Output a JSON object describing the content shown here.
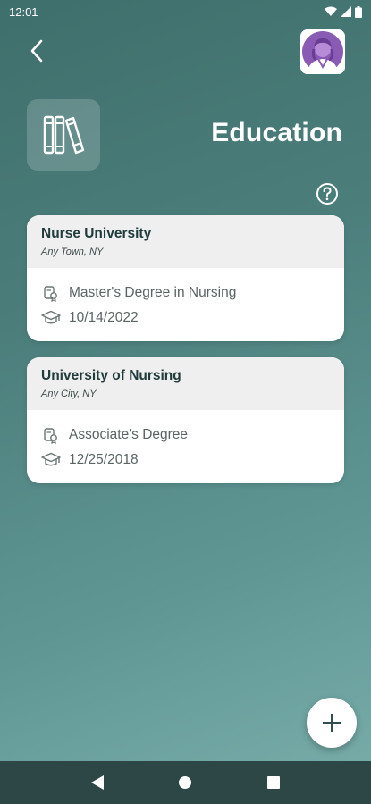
{
  "status_bar": {
    "time": "12:01",
    "icons": [
      "wifi-icon",
      "signal-icon",
      "battery-icon"
    ]
  },
  "header": {
    "back_icon": "chevron-left-icon",
    "section_icon": "books-icon",
    "title": "Education",
    "help_icon": "question-circle-icon",
    "avatar": "nurse-avatar"
  },
  "education": [
    {
      "school": "Nurse University",
      "location": "Any Town, NY",
      "degree": "Master's Degree in Nursing",
      "date": "10/14/2022"
    },
    {
      "school": "University of Nursing",
      "location": "Any City, NY",
      "degree": "Associate's Degree",
      "date": "12/25/2018"
    }
  ],
  "fab": {
    "icon": "plus-icon"
  },
  "nav_bar": {
    "icons": [
      "back-triangle-icon",
      "home-circle-icon",
      "recents-square-icon"
    ]
  },
  "colors": {
    "background_top": "#3f6f6c",
    "background_bottom": "#7aaeab",
    "card_header": "#efefef",
    "card_title": "#213c3c",
    "nav_bar": "#2c4745",
    "avatar_purple": "#8a5bb5"
  }
}
